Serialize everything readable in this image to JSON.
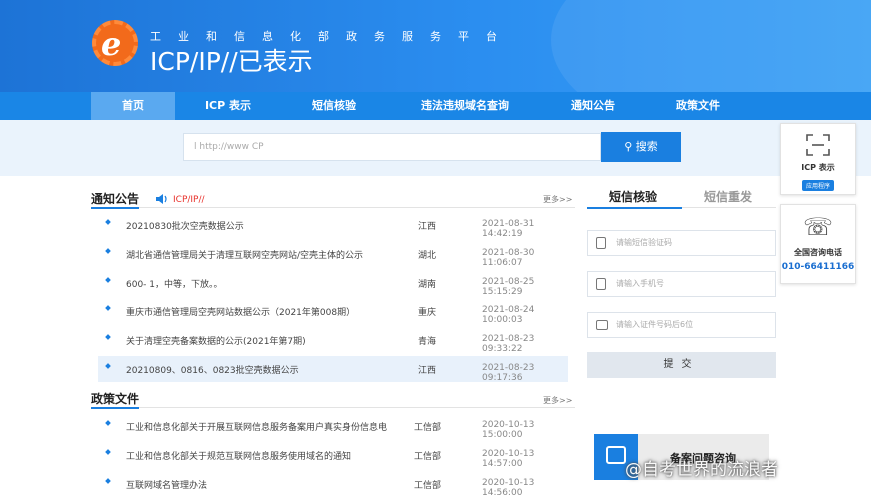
{
  "header": {
    "subtitle": "工业和信息化部政务服务平台",
    "title": "ICP/IP//已表示"
  },
  "nav": [
    "首页",
    "ICP 表示",
    "短信核验",
    "违法违规域名查询",
    "通知公告",
    "政策文件"
  ],
  "search": {
    "placeholder": "l http://www CP",
    "button": "搜索"
  },
  "notices": {
    "title": "通知公告",
    "ticker": "ICP/IP//",
    "more": "更多>>",
    "rows": [
      {
        "title": "20210830批次空壳数据公示",
        "province": "江西",
        "date": "2021-08-31 14:42:19"
      },
      {
        "title": "湖北省通信管理局关于清理互联网空壳网站/空壳主体的公示",
        "province": "湖北",
        "date": "2021-08-30 11:06:07"
      },
      {
        "title": "600- 1，中等，下放。。",
        "province": "湖南",
        "date": "2021-08-25 15:15:29"
      },
      {
        "title": "重庆市通信管理局空壳网站数据公示（2021年第008期）",
        "province": "重庆",
        "date": "2021-08-24 10:00:03"
      },
      {
        "title": "关于清理空壳备案数据的公示(2021年第7期)",
        "province": "青海",
        "date": "2021-08-23 09:33:22"
      },
      {
        "title": "20210809、0816、0823批空壳数据公示",
        "province": "江西",
        "date": "2021-08-23 09:17:36"
      }
    ]
  },
  "policy": {
    "title": "政策文件",
    "more": "更多>>",
    "rows": [
      {
        "title": "工业和信息化部关于开展互联网信息服务备案用户真实身份信息电",
        "province": "工信部",
        "date": "2020-10-13 15:00:00"
      },
      {
        "title": "工业和信息化部关于规范互联网信息服务使用域名的通知",
        "province": "工信部",
        "date": "2020-10-13 14:57:00"
      },
      {
        "title": "互联网域名管理办法",
        "province": "工信部",
        "date": "2020-10-13 14:56:00"
      }
    ]
  },
  "sms": {
    "tab_active": "短信核验",
    "tab_inactive": "短信重发",
    "code_placeholder": "请输短信验证码",
    "phone_placeholder": "请输入手机号",
    "id_placeholder": "请输入证件号码后6位",
    "submit": "提交"
  },
  "beian": {
    "label": "备案问题咨询"
  },
  "side": {
    "icp_label": "ICP 表示",
    "icp_badge": "应用程序",
    "phone_label": "全国咨询电话",
    "phone_number": "010-66411166"
  },
  "watermark": "@自考世界的流浪者",
  "colors": {
    "primary": "#1a7fe0",
    "nav": "#1a86e6",
    "accent_red": "#e8322c"
  }
}
